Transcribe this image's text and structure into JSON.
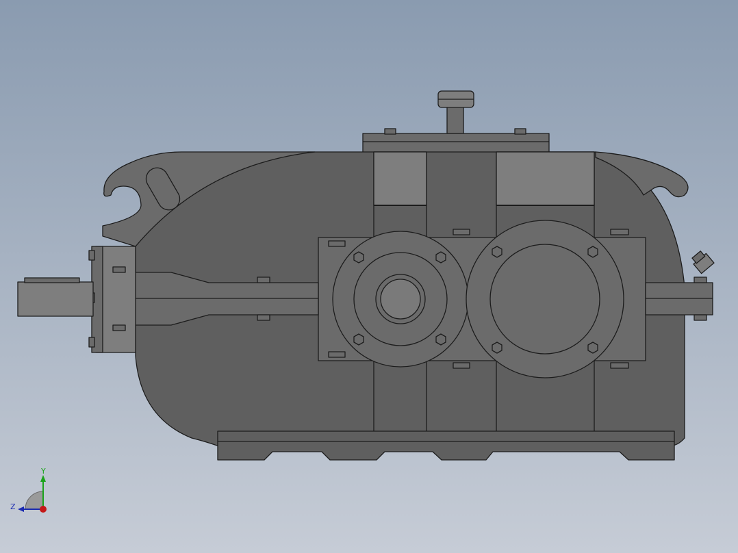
{
  "viewport": {
    "background_top": "#8a9bb0",
    "background_bottom": "#c6ccd6",
    "model": {
      "body_color": "#5f5f5f",
      "face_color": "#6b6b6b",
      "light_color": "#7e7e7e",
      "edge_color": "#1c1c1c"
    },
    "triad": {
      "y_label": "Y",
      "z_label": "Z",
      "y_color": "#1aa31a",
      "z_color": "#1a2ab0",
      "x_color": "#c41818"
    }
  }
}
